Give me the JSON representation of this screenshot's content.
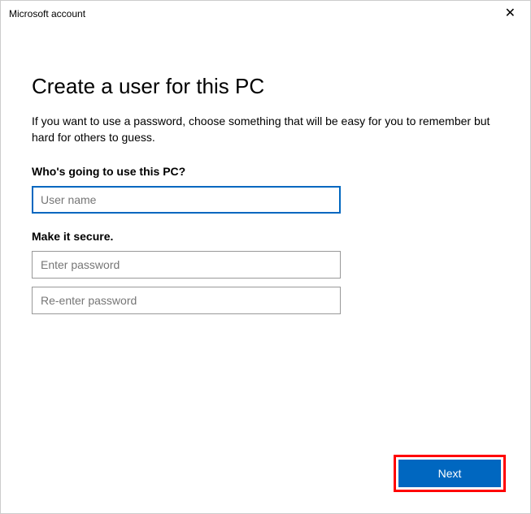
{
  "titlebar": {
    "title": "Microsoft account",
    "close_glyph": "✕"
  },
  "page": {
    "heading": "Create a user for this PC",
    "subtitle": "If you want to use a password, choose something that will be easy for you to remember but hard for others to guess."
  },
  "username_section": {
    "label": "Who's going to use this PC?",
    "placeholder": "User name",
    "value": ""
  },
  "password_section": {
    "label": "Make it secure.",
    "password_placeholder": "Enter password",
    "password_value": "",
    "confirm_placeholder": "Re-enter password",
    "confirm_value": ""
  },
  "footer": {
    "next_label": "Next"
  }
}
